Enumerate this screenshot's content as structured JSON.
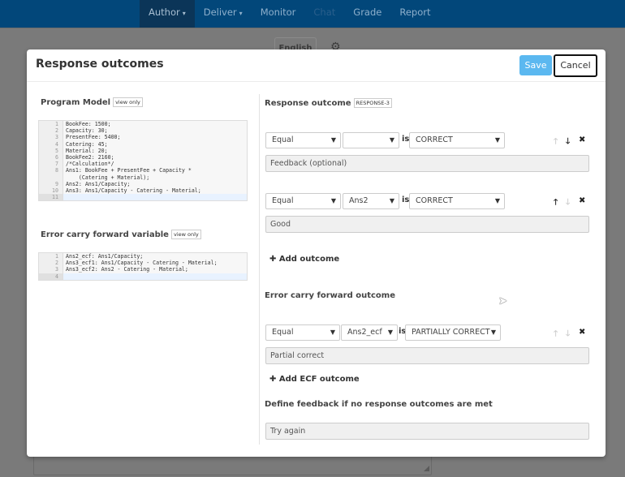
{
  "nav": {
    "items": [
      {
        "label": "Author",
        "has_dropdown": true,
        "state": "active"
      },
      {
        "label": "Deliver",
        "has_dropdown": true,
        "state": "normal"
      },
      {
        "label": "Monitor",
        "has_dropdown": false,
        "state": "normal"
      },
      {
        "label": "Chat",
        "has_dropdown": false,
        "state": "disabled"
      },
      {
        "label": "Grade",
        "has_dropdown": false,
        "state": "normal"
      },
      {
        "label": "Report",
        "has_dropdown": false,
        "state": "normal"
      }
    ],
    "dropdown_icon": "chevron-down-icon"
  },
  "background": {
    "language_label": "English",
    "settings_icon": "gear-icon"
  },
  "modal": {
    "title": "Response outcomes",
    "save_label": "Save",
    "cancel_label": "Cancel",
    "program_model": {
      "label": "Program Model",
      "tag": "view only",
      "lines": [
        {
          "n": "1",
          "text": "BookFee: 1500;"
        },
        {
          "n": "2",
          "text": "Capacity: 30;"
        },
        {
          "n": "3",
          "text": "PresentFee: 5400;"
        },
        {
          "n": "4",
          "text": "Catering: 45;"
        },
        {
          "n": "5",
          "text": "Material: 20;"
        },
        {
          "n": "6",
          "text": "BookFee2: 2160;"
        },
        {
          "n": "7",
          "text": "/*Calculation*/"
        },
        {
          "n": "8",
          "text": "Ans1: BookFee + PresentFee + Capacity *"
        },
        {
          "n": "",
          "text": "    (Catering + Material);"
        },
        {
          "n": "9",
          "text": "Ans2: Ans1/Capacity;"
        },
        {
          "n": "10",
          "text": "Ans3: Ans1/Capacity - Catering - Material;"
        },
        {
          "n": "11",
          "text": ""
        }
      ]
    },
    "ecf_variable": {
      "label": "Error carry forward variable",
      "tag": "view only",
      "lines": [
        {
          "n": "1",
          "text": "Ans2_ecf: Ans1/Capacity;"
        },
        {
          "n": "2",
          "text": "Ans3_ecf1: Ans1/Capacity - Catering - Material;"
        },
        {
          "n": "3",
          "text": "Ans3_ecf2: Ans2 - Catering - Material;"
        },
        {
          "n": "4",
          "text": ""
        }
      ]
    },
    "response_outcome": {
      "label": "Response outcome",
      "tag": "RESPONSE-3",
      "is_label": "is",
      "outcomes": [
        {
          "operator": "Equal",
          "variable": "",
          "result": "CORRECT",
          "feedback": "Feedback (optional)",
          "feedback_is_placeholder": true,
          "up_enabled": false,
          "down_enabled": true
        },
        {
          "operator": "Equal",
          "variable": "Ans2",
          "result": "CORRECT",
          "feedback": "Good",
          "feedback_is_placeholder": false,
          "up_enabled": true,
          "down_enabled": false
        }
      ],
      "add_label": "Add outcome"
    },
    "ecf_outcome": {
      "label": "Error carry forward outcome",
      "outcomes": [
        {
          "operator": "Equal",
          "variable": "Ans2_ecf",
          "result": "PARTIALLY CORRECT",
          "feedback": "Partial correct",
          "up_enabled": false,
          "down_enabled": false
        }
      ],
      "add_label": "Add ECF outcome"
    },
    "fallback": {
      "label": "Define feedback if no response outcomes are met",
      "value": "Try again"
    }
  },
  "icons": {
    "up": "↑",
    "down": "↓",
    "remove": "✖",
    "plus": "✚",
    "chevron": "⌄"
  }
}
